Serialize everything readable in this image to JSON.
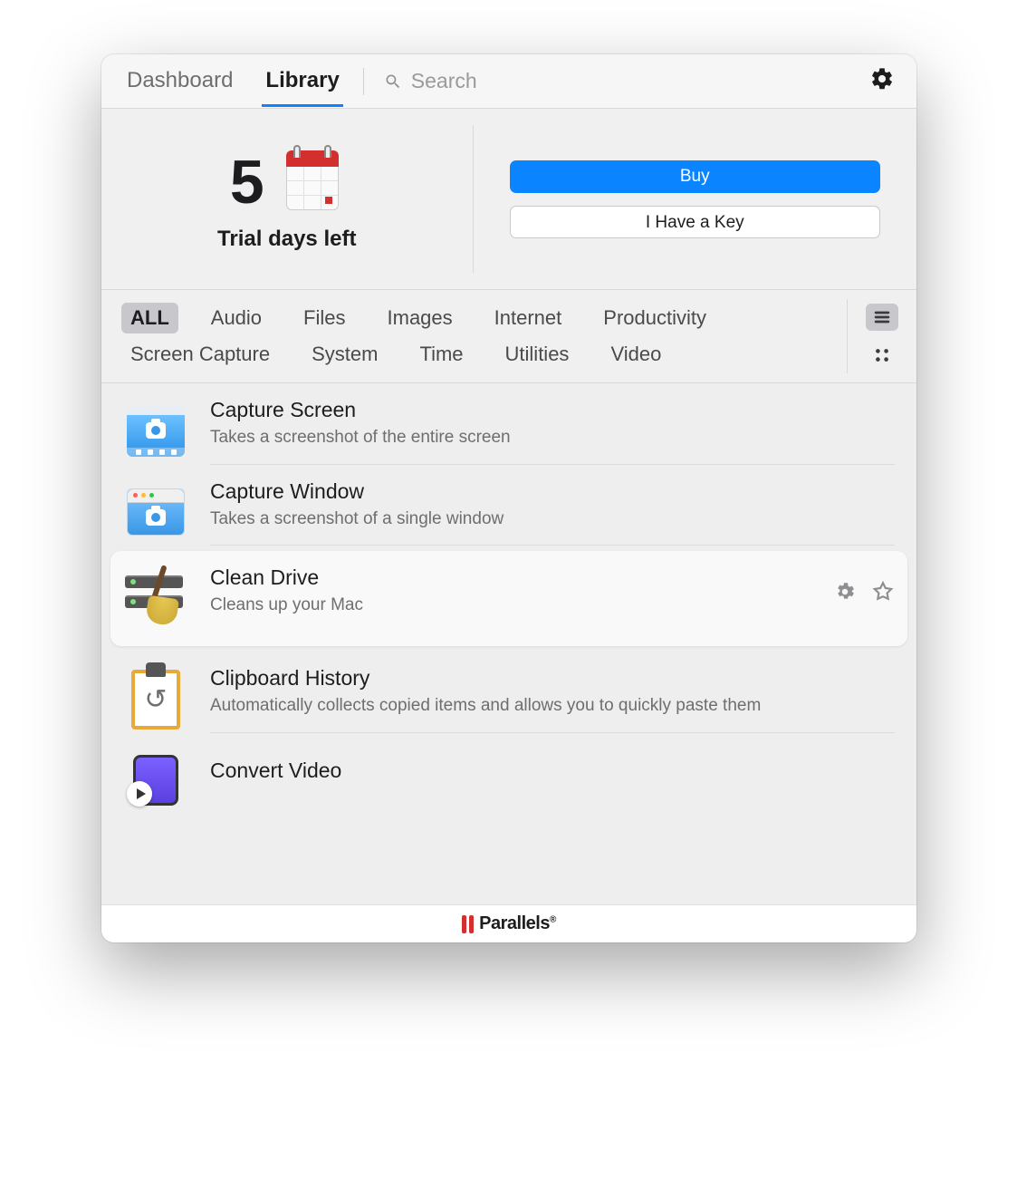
{
  "header": {
    "tabs": {
      "dashboard": "Dashboard",
      "library": "Library"
    },
    "active_tab": "library",
    "search_placeholder": "Search"
  },
  "trial": {
    "days_left": "5",
    "caption": "Trial days left",
    "buy_label": "Buy",
    "key_label": "I Have a Key"
  },
  "filters": {
    "tags": [
      "ALL",
      "Audio",
      "Files",
      "Images",
      "Internet",
      "Productivity",
      "Screen Capture",
      "System",
      "Time",
      "Utilities",
      "Video"
    ],
    "active_tag": "ALL"
  },
  "tools": [
    {
      "id": "capture-screen",
      "title": "Capture Screen",
      "desc": "Takes a screenshot of the entire screen",
      "selected": false
    },
    {
      "id": "capture-window",
      "title": "Capture Window",
      "desc": "Takes a screenshot of a single window",
      "selected": false
    },
    {
      "id": "clean-drive",
      "title": "Clean Drive",
      "desc": "Cleans up your Mac",
      "selected": true
    },
    {
      "id": "clipboard-history",
      "title": "Clipboard History",
      "desc": "Automatically collects copied items and allows you to quickly paste them",
      "selected": false
    },
    {
      "id": "convert-video",
      "title": "Convert Video",
      "desc": "",
      "selected": false
    }
  ],
  "footer": {
    "brand": "Parallels"
  }
}
